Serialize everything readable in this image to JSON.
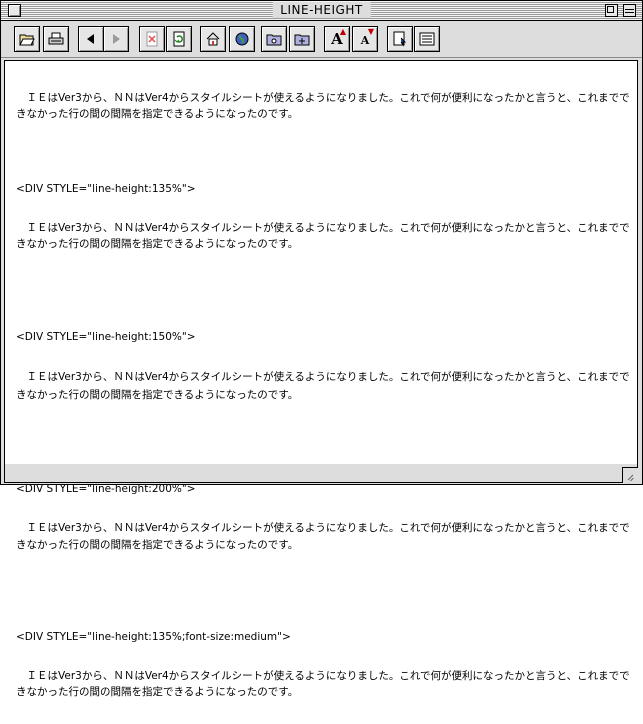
{
  "window": {
    "title": "LINE-HEIGHT"
  },
  "toolbar": {
    "buttons": [
      {
        "name": "open-folder-icon"
      },
      {
        "name": "print-icon"
      },
      {
        "name": "back-arrow-icon"
      },
      {
        "name": "forward-arrow-icon"
      },
      {
        "name": "stop-icon"
      },
      {
        "name": "reload-icon"
      },
      {
        "name": "home-icon"
      },
      {
        "name": "globe-icon"
      },
      {
        "name": "bookmark-folder-icon"
      },
      {
        "name": "bookmark-add-icon"
      },
      {
        "name": "font-larger-icon",
        "glyph": "A"
      },
      {
        "name": "font-smaller-icon",
        "glyph": "A"
      },
      {
        "name": "source-icon"
      },
      {
        "name": "list-icon"
      }
    ]
  },
  "content": {
    "paragraph": "　ＩＥはVer3から、ＮＮはVer4からスタイルシートが使えるようになりました。これで何が便利になったかと言うと、これまでできなかった行の間の間隔を指定できるようになったのです。",
    "div1": "<DIV STYLE=\"line-height:135%\">",
    "div2": "<DIV STYLE=\"line-height:150%\">",
    "div3": "<DIV STYLE=\"line-height:200%\">",
    "div4": "<DIV STYLE=\"line-height:135%;font-size:medium\">"
  },
  "colors": {
    "chrome": "#dddddd",
    "content_bg": "#ffffff",
    "text": "#000000"
  }
}
